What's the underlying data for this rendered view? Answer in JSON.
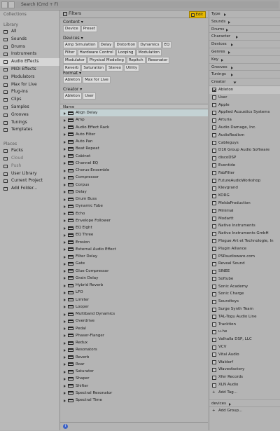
{
  "search": {
    "placeholder": "Search (Cmd + F)"
  },
  "sidebar": {
    "collections_label": "Collections",
    "library_label": "Library",
    "library_items": [
      {
        "label": "All"
      },
      {
        "label": "Sounds"
      },
      {
        "label": "Drums"
      },
      {
        "label": "Instruments"
      },
      {
        "label": "Audio Effects"
      },
      {
        "label": "MIDI Effects"
      },
      {
        "label": "Modulators"
      },
      {
        "label": "Max for Live"
      },
      {
        "label": "Plug-Ins"
      },
      {
        "label": "Clips"
      },
      {
        "label": "Samples"
      },
      {
        "label": "Grooves"
      },
      {
        "label": "Tunings"
      },
      {
        "label": "Templates"
      }
    ],
    "places_label": "Places",
    "places_items": [
      {
        "label": "Packs"
      },
      {
        "label": "Cloud"
      },
      {
        "label": "Push"
      },
      {
        "label": "User Library"
      },
      {
        "label": "Current Project"
      },
      {
        "label": "Add Folder..."
      }
    ]
  },
  "filters": {
    "label": "Filters",
    "edit_label": "Edit",
    "content": {
      "label": "Content",
      "chips": [
        "Device",
        "Preset"
      ]
    },
    "devices": {
      "label": "Devices",
      "chips": [
        "Amp Simulation",
        "Delay",
        "Distortion",
        "Dynamics",
        "EQ",
        "Filter",
        "Hardware Control",
        "Looping",
        "Modulation",
        "Modulator",
        "Physical Modeling",
        "Repitch",
        "Resonator",
        "Reverb",
        "Saturation",
        "Stereo",
        "Utility"
      ]
    },
    "format": {
      "label": "Format",
      "chips": [
        "Ableton",
        "Max for Live"
      ]
    },
    "creator": {
      "label": "Creator",
      "chips": [
        "Ableton",
        "User"
      ]
    }
  },
  "list": {
    "name_header": "Name",
    "items": [
      "Align Delay",
      "Amp",
      "Audio Effect Rack",
      "Auto Filter",
      "Auto Pan",
      "Beat Repeat",
      "Cabinet",
      "Channel EQ",
      "Chorus-Ensemble",
      "Compressor",
      "Corpus",
      "Delay",
      "Drum Buss",
      "Dynamic Tube",
      "Echo",
      "Envelope Follower",
      "EQ Eight",
      "EQ Three",
      "Erosion",
      "External Audio Effect",
      "Filter Delay",
      "Gate",
      "Glue Compressor",
      "Grain Delay",
      "Hybrid Reverb",
      "LFO",
      "Limiter",
      "Looper",
      "Multiband Dynamics",
      "Overdrive",
      "Pedal",
      "Phaser-Flanger",
      "Redux",
      "Resonators",
      "Reverb",
      "Roar",
      "Saturator",
      "Shaper",
      "Shifter",
      "Spectral Resonator",
      "Spectral Time"
    ]
  },
  "tags": {
    "categories": [
      "Type",
      "Sounds",
      "Drums",
      "Character",
      "Devices",
      "Genres",
      "Key",
      "Grooves",
      "Tunings"
    ],
    "creator_label": "Creator",
    "creators": [
      {
        "label": "Ableton",
        "checked": true
      },
      {
        "label": "User"
      },
      {
        "label": "Apple"
      },
      {
        "label": "Applied Acoustics Systems"
      },
      {
        "label": "Arturia"
      },
      {
        "label": "Audio Damage, Inc."
      },
      {
        "label": "AudioRealism"
      },
      {
        "label": "Cableguys"
      },
      {
        "label": "D16 Group Audio Software"
      },
      {
        "label": "discoDSP"
      },
      {
        "label": "Eventide"
      },
      {
        "label": "FabFilter"
      },
      {
        "label": "FutureAudioWorkshop"
      },
      {
        "label": "Klevgrand"
      },
      {
        "label": "KORG"
      },
      {
        "label": "MeldaProduction"
      },
      {
        "label": "Minimal"
      },
      {
        "label": "Modartt"
      },
      {
        "label": "Native Instruments"
      },
      {
        "label": "Native Instruments GmbH"
      },
      {
        "label": "Plogue Art et Technologie, In"
      },
      {
        "label": "Plugin Alliance"
      },
      {
        "label": "PSPaudioware.com"
      },
      {
        "label": "Reveal Sound"
      },
      {
        "label": "SINEE"
      },
      {
        "label": "Softube"
      },
      {
        "label": "Sonic Academy"
      },
      {
        "label": "Sonic Charge"
      },
      {
        "label": "Soundtoys"
      },
      {
        "label": "Surge Synth Team"
      },
      {
        "label": "TAL-Togu Audio Line"
      },
      {
        "label": "Tracktion"
      },
      {
        "label": "u-he"
      },
      {
        "label": "Valhalla DSP, LLC"
      },
      {
        "label": "VCV"
      },
      {
        "label": "Vital Audio"
      },
      {
        "label": "Waldorf"
      },
      {
        "label": "Wavesfactory"
      },
      {
        "label": "Xfer Records"
      },
      {
        "label": "XLN Audio"
      }
    ],
    "add_tag_label": "Add Tag...",
    "devices_collapsed_label": "devices",
    "add_group_label": "Add Group..."
  },
  "colors": {
    "accent_edit": "#e7b900",
    "selected_row": "#c4d2d4",
    "info": "#3e63c7"
  }
}
